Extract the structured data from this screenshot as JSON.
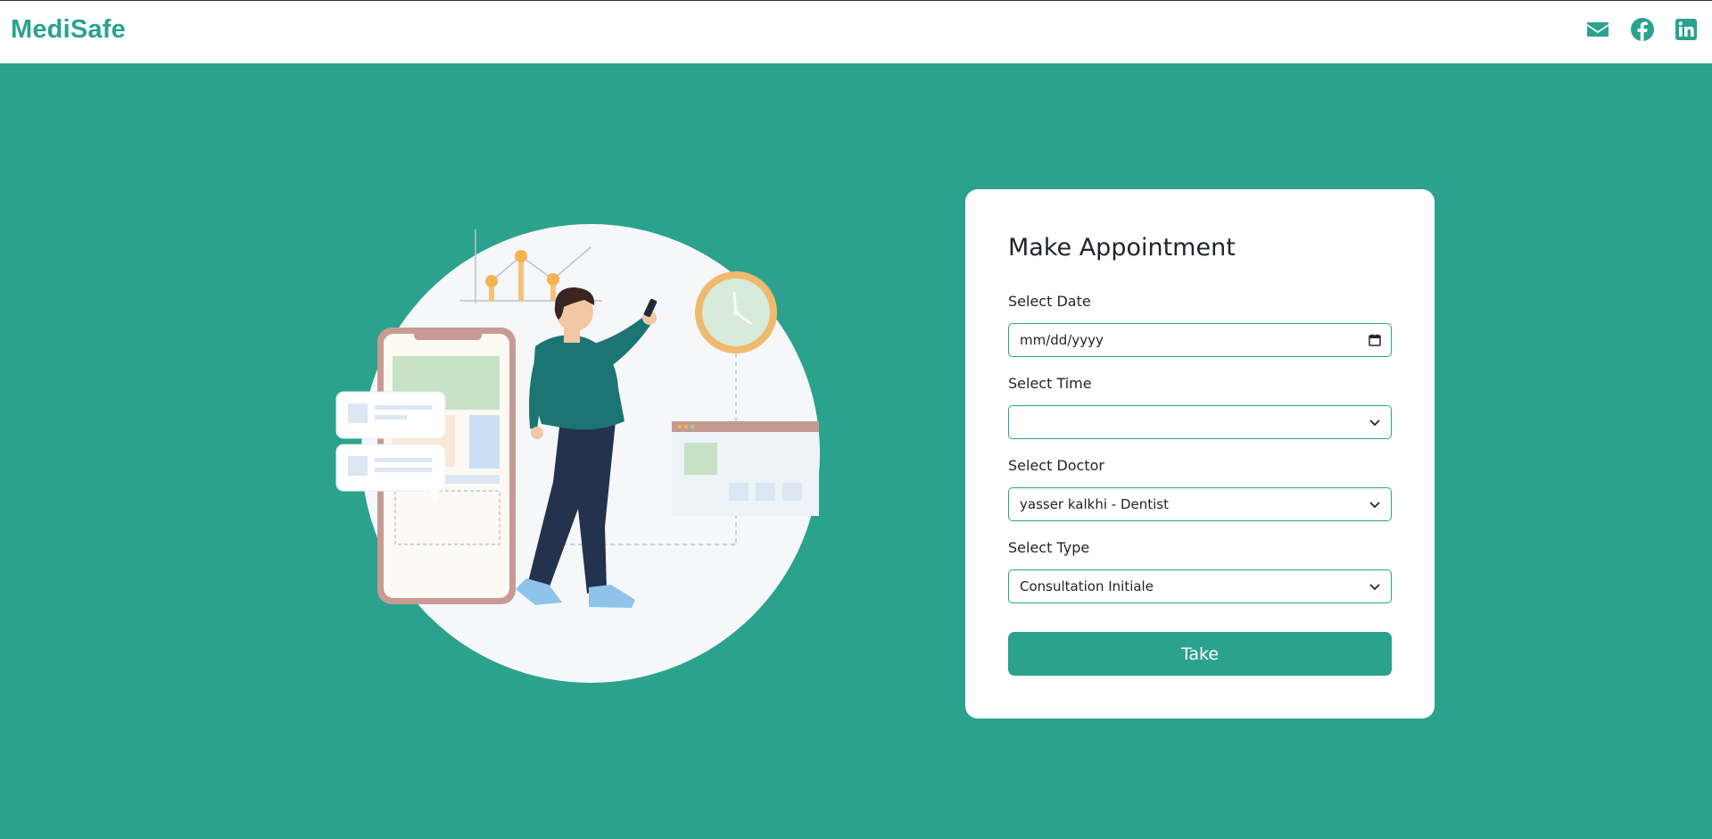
{
  "header": {
    "brand": "MediSafe",
    "social_icons": [
      "envelope-icon",
      "facebook-icon",
      "linkedin-icon"
    ]
  },
  "appointment_form": {
    "title": "Make Appointment",
    "date": {
      "label": "Select Date",
      "placeholder": "mm/dd/yyyy"
    },
    "time": {
      "label": "Select Time",
      "value": ""
    },
    "doctor": {
      "label": "Select Doctor",
      "value": "yasser kalkhi - Dentist"
    },
    "type": {
      "label": "Select Type",
      "value": "Consultation Initiale"
    },
    "submit_label": "Take"
  },
  "colors": {
    "brand": "#2ba28e",
    "card_background": "#ffffff",
    "text": "#212529"
  }
}
